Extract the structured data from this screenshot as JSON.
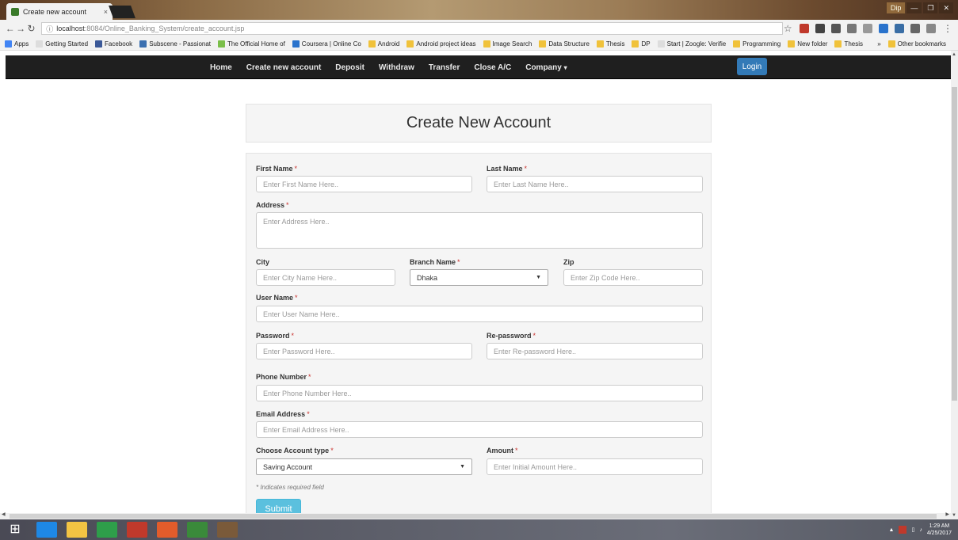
{
  "browser": {
    "tab_title": "Create new account",
    "tab_close": "×",
    "url_host": "localhost",
    "url_rest": ":8084/Online_Banking_System/create_account.jsp",
    "bookmarks": [
      {
        "label": "Apps",
        "color": "#4285f4"
      },
      {
        "label": "Getting Started",
        "color": "#dddddd"
      },
      {
        "label": "Facebook",
        "color": "#3b5998"
      },
      {
        "label": "Subscene - Passionat",
        "color": "#3a6fb0"
      },
      {
        "label": "The Official Home of",
        "color": "#7bbf4a"
      },
      {
        "label": "Coursera | Online Co",
        "color": "#2a73cc"
      },
      {
        "label": "Android",
        "color": "#f0c23b"
      },
      {
        "label": "Android project ideas",
        "color": "#f0c23b"
      },
      {
        "label": "Image Search",
        "color": "#f0c23b"
      },
      {
        "label": "Data Structure",
        "color": "#f0c23b"
      },
      {
        "label": "Thesis",
        "color": "#f0c23b"
      },
      {
        "label": "DP",
        "color": "#f0c23b"
      },
      {
        "label": "Start | Zoogle: Verifie",
        "color": "#dddddd"
      },
      {
        "label": "Programming",
        "color": "#f0c23b"
      },
      {
        "label": "New folder",
        "color": "#f0c23b"
      },
      {
        "label": "Thesis",
        "color": "#f0c23b"
      }
    ],
    "more_bookmarks": "»",
    "other_bookmarks": "Other bookmarks",
    "window_user": "Dip"
  },
  "nav": {
    "items": [
      "Home",
      "Create new account",
      "Deposit",
      "Withdraw",
      "Transfer",
      "Close A/C",
      "Company"
    ],
    "login": "Login"
  },
  "page": {
    "title": "Create New Account",
    "required_mark": "*",
    "first_name": {
      "label": "First Name",
      "placeholder": "Enter First Name Here.."
    },
    "last_name": {
      "label": "Last Name",
      "placeholder": "Enter Last Name Here.."
    },
    "address": {
      "label": "Address",
      "placeholder": "Enter Address Here.."
    },
    "city": {
      "label": "City",
      "placeholder": "Enter City Name Here.."
    },
    "branch": {
      "label": "Branch Name",
      "value": "Dhaka"
    },
    "zip": {
      "label": "Zip",
      "placeholder": "Enter Zip Code Here.."
    },
    "username": {
      "label": "User Name",
      "placeholder": "Enter User Name Here.."
    },
    "password": {
      "label": "Password",
      "placeholder": "Enter Password Here.."
    },
    "repassword": {
      "label": "Re-password",
      "placeholder": "Enter Re-password Here.."
    },
    "phone": {
      "label": "Phone Number",
      "placeholder": "Enter Phone Number Here.."
    },
    "email": {
      "label": "Email Address",
      "placeholder": "Enter Email Address Here.."
    },
    "account_type": {
      "label": "Choose Account type",
      "value": "Saving Account"
    },
    "amount": {
      "label": "Amount",
      "placeholder": "Enter Initial Amount Here.."
    },
    "required_note": "* Indicates required field",
    "submit": "Submit"
  },
  "taskbar": {
    "time": "1:29 AM",
    "date": "4/25/2017"
  }
}
